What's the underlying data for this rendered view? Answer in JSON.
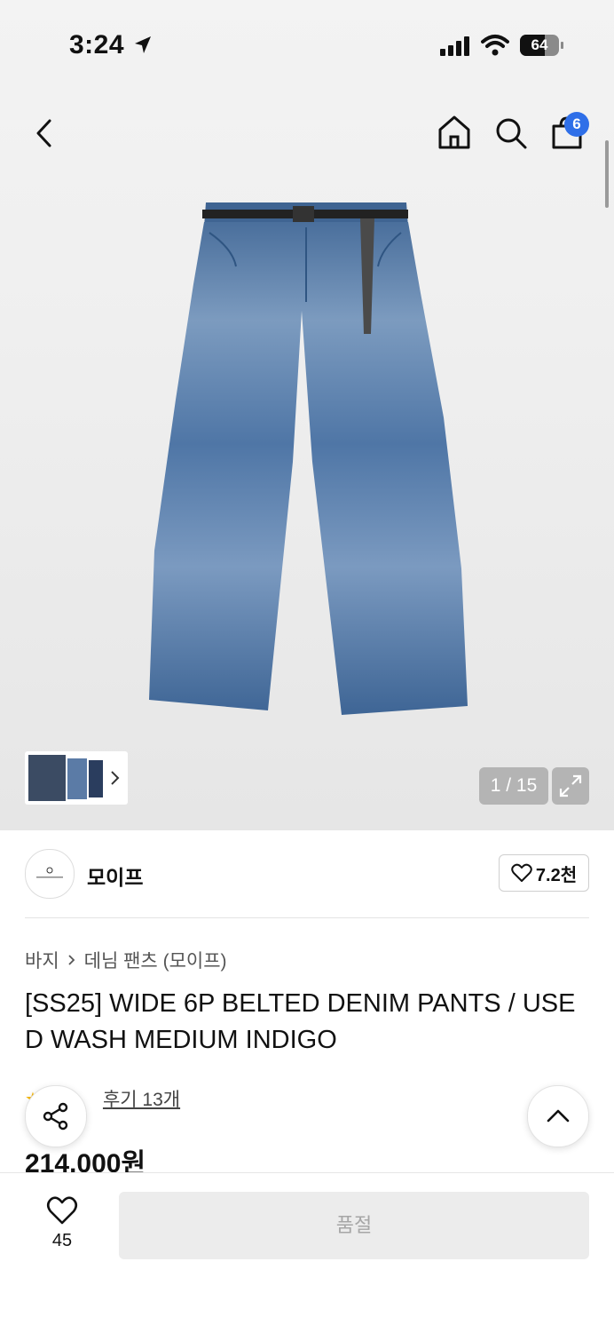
{
  "status_bar": {
    "time": "3:24",
    "battery": "64"
  },
  "nav": {
    "cart_count": "6"
  },
  "gallery": {
    "counter": "1 / 15"
  },
  "brand": {
    "name": "모이프",
    "like_count": "7.2천"
  },
  "breadcrumb": {
    "category": "바지",
    "subcategory": "데님 팬츠 (모이프)"
  },
  "product": {
    "title": "[SS25] WIDE 6P BELTED DENIM PANTS / USED WASH MEDIUM INDIGO",
    "review_link": "후기 13개",
    "price": "214,000원"
  },
  "bottom": {
    "wish_count": "45",
    "buy_label": "품절"
  }
}
